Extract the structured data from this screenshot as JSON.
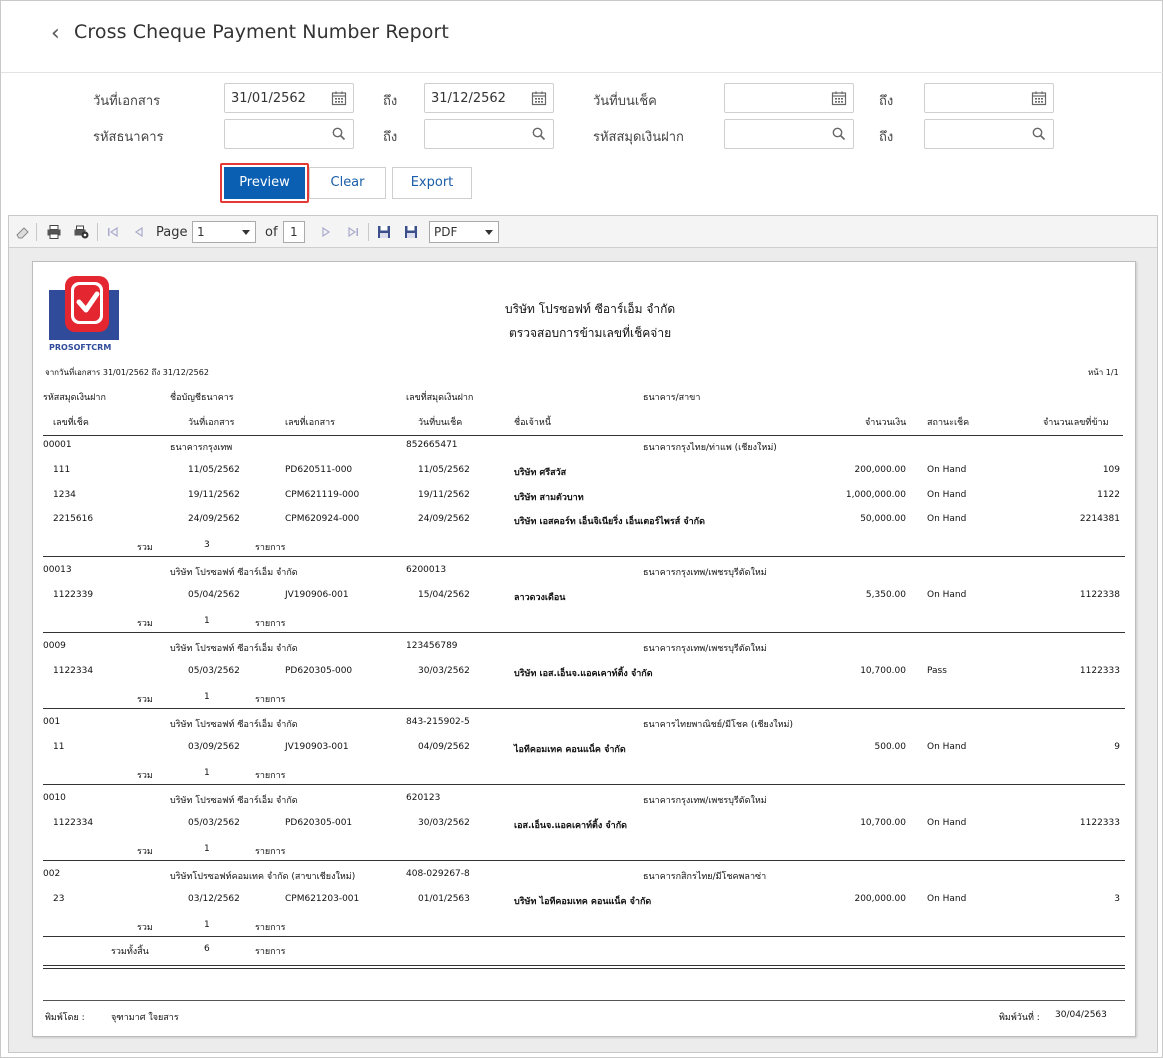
{
  "header": {
    "back_icon": "chevron-left",
    "title": "Cross Cheque Payment Number Report"
  },
  "filters": {
    "doc_date_label": "วันที่เอกสาร",
    "doc_date_from": "31/01/2562",
    "to_label": "ถึง",
    "doc_date_to": "31/12/2562",
    "cheque_date_label": "วันที่บนเช็ค",
    "cheque_date_from": "",
    "cheque_date_to": "",
    "bank_code_label": "รหัสธนาคาร",
    "bank_code_from": "",
    "bank_code_to": "",
    "passbook_code_label": "รหัสสมุดเงินฝาก",
    "passbook_code_from": "",
    "passbook_code_to": ""
  },
  "actions": {
    "preview": "Preview",
    "clear": "Clear",
    "export": "Export"
  },
  "toolbar": {
    "page_label": "Page",
    "page_value": "1",
    "of_label": "of",
    "total_pages": "1",
    "format": "PDF"
  },
  "report": {
    "logo_text": "PROSOFTCRM",
    "company": "บริษัท โปรซอฟท์ ซีอาร์เอ็ม จำกัด",
    "title": "ตรวจสอบการข้ามเลขที่เช็คจ่าย",
    "range": "จากวันที่เอกสาร 31/01/2562 ถึง 31/12/2562",
    "page_info": "หน้า 1/1",
    "columns": {
      "passbook_code": "รหัสสมุดเงินฝาก",
      "account_name": "ชื่อบัญชีธนาคาร",
      "passbook_no": "เลขที่สมุดเงินฝาก",
      "bank_branch": "ธนาคาร/สาขา",
      "cheque_no": "เลขที่เช็ค",
      "doc_date": "วันที่เอกสาร",
      "doc_no": "เลขที่เอกสาร",
      "cheque_date": "วันที่บนเช็ค",
      "creditor": "ชื่อเจ้าหนี้",
      "amount": "จำนวนเงิน",
      "status": "สถานะเช็ค",
      "skip_count": "จำนวนเลขที่ข้าม"
    },
    "sum_label": "รวม",
    "items_label": "รายการ",
    "groups": [
      {
        "code": "00001",
        "account": "ธนาคารกรุงเทพ",
        "passbook": "852665471",
        "bank": "ธนาคารกรุงไทย/ท่าแพ (เชียงใหม่)",
        "rows": [
          {
            "cheque": "111",
            "doc_date": "11/05/2562",
            "doc_no": "PD620511-000",
            "cheque_date": "11/05/2562",
            "creditor": "บริษัท ศรีสวัส",
            "amount": "200,000.00",
            "status": "On Hand",
            "skip": "109"
          },
          {
            "cheque": "1234",
            "doc_date": "19/11/2562",
            "doc_no": "CPM621119-000",
            "cheque_date": "19/11/2562",
            "creditor": "บริษัท สามตัวบาท",
            "amount": "1,000,000.00",
            "status": "On Hand",
            "skip": "1122"
          },
          {
            "cheque": "2215616",
            "doc_date": "24/09/2562",
            "doc_no": "CPM620924-000",
            "cheque_date": "24/09/2562",
            "creditor": "บริษัท เอสคอร์ท เอ็นจิเนียริ่ง เอ็นเตอร์ไพรส์ จำกัด",
            "amount": "50,000.00",
            "status": "On Hand",
            "skip": "2214381"
          }
        ],
        "count": "3"
      },
      {
        "code": "00013",
        "account": "บริษัท โปรซอฟท์ ซีอาร์เอ็ม จำกัด",
        "passbook": "6200013",
        "bank": "ธนาคารกรุงเทพ/เพชรบุรีตัดใหม่",
        "rows": [
          {
            "cheque": "1122339",
            "doc_date": "05/04/2562",
            "doc_no": "JV190906-001",
            "cheque_date": "15/04/2562",
            "creditor": "ลาวดวงเดือน",
            "amount": "5,350.00",
            "status": "On Hand",
            "skip": "1122338"
          }
        ],
        "count": "1"
      },
      {
        "code": "0009",
        "account": "บริษัท โปรซอฟท์ ซีอาร์เอ็ม จำกัด",
        "passbook": "123456789",
        "bank": "ธนาคารกรุงเทพ/เพชรบุรีตัดใหม่",
        "rows": [
          {
            "cheque": "1122334",
            "doc_date": "05/03/2562",
            "doc_no": "PD620305-000",
            "cheque_date": "30/03/2562",
            "creditor": "บริษัท เอส.เอ็นจ.แอคเคาท์ติ้ง จำกัด",
            "amount": "10,700.00",
            "status": "Pass",
            "skip": "1122333"
          }
        ],
        "count": "1"
      },
      {
        "code": "001",
        "account": "บริษัท โปรซอฟท์ ซีอาร์เอ็ม จำกัด",
        "passbook": "843-215902-5",
        "bank": "ธนาคารไทยพาณิชย์/มีโชค (เชียงใหม่)",
        "rows": [
          {
            "cheque": "11",
            "doc_date": "03/09/2562",
            "doc_no": "JV190903-001",
            "cheque_date": "04/09/2562",
            "creditor": "ไอทีคอมเทค คอนแน็ค จำกัด",
            "amount": "500.00",
            "status": "On Hand",
            "skip": "9"
          }
        ],
        "count": "1"
      },
      {
        "code": "0010",
        "account": "บริษัท โปรซอฟท์ ซีอาร์เอ็ม จำกัด",
        "passbook": "620123",
        "bank": "ธนาคารกรุงเทพ/เพชรบุรีตัดใหม่",
        "rows": [
          {
            "cheque": "1122334",
            "doc_date": "05/03/2562",
            "doc_no": "PD620305-001",
            "cheque_date": "30/03/2562",
            "creditor": "เอส.เอ็นจ.แอคเคาท์ติ้ง จำกัด",
            "amount": "10,700.00",
            "status": "On Hand",
            "skip": "1122333"
          }
        ],
        "count": "1"
      },
      {
        "code": "002",
        "account": "บริษัทโปรซอฟท์คอมเทค จำกัด (สาขาเชียงใหม่)",
        "passbook": "408-029267-8",
        "bank": "ธนาคารกสิกรไทย/มีโชคพลาซ่า",
        "rows": [
          {
            "cheque": "23",
            "doc_date": "03/12/2562",
            "doc_no": "CPM621203-001",
            "cheque_date": "01/01/2563",
            "creditor": "บริษัท ไอทีคอมเทค คอนแน็ค จำกัด",
            "amount": "200,000.00",
            "status": "On Hand",
            "skip": "3"
          }
        ],
        "count": "1"
      }
    ],
    "grand_total_label": "รวมทั้งสิ้น",
    "grand_total_count": "6",
    "printed_by_label": "พิมพ์โดย :",
    "printed_by": "จุฑามาศ ใจยสาร",
    "printed_date_label": "พิมพ์วันที่ :",
    "printed_date": "30/04/2563"
  }
}
